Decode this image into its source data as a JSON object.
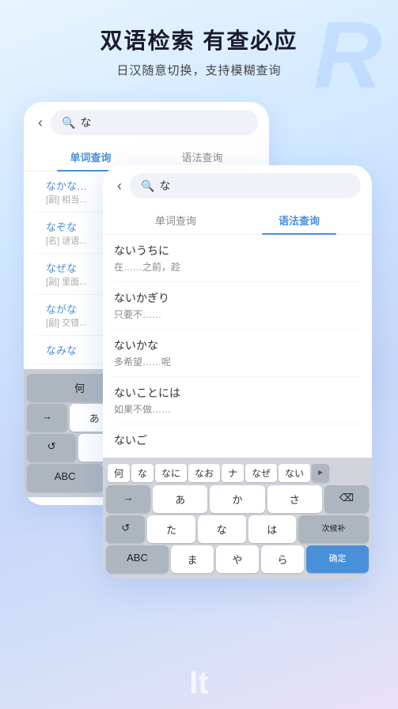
{
  "header": {
    "title": "双语检索 有查必应",
    "subtitle": "日汉随意切换，支持模糊查询",
    "bg_logo": "R"
  },
  "back_card": {
    "back_btn": "‹",
    "search_query": "な",
    "search_placeholder": "な",
    "tabs": [
      {
        "label": "单词查询",
        "active": true
      },
      {
        "label": "语法查询",
        "active": false
      }
    ],
    "results": [
      {
        "japanese": "なかな...",
        "tag": "[副]",
        "desc": "相当..."
      },
      {
        "japanese": "なぞな",
        "tag": "[名]",
        "desc": "谜语..."
      },
      {
        "japanese": "なぜな",
        "tag": "[副]",
        "desc": "里面..."
      },
      {
        "japanese": "ながな",
        "tag": "[副]",
        "desc": "交错..."
      }
    ]
  },
  "front_card": {
    "back_btn": "‹",
    "search_query": "な",
    "tabs": [
      {
        "label": "单词查询",
        "active": false
      },
      {
        "label": "语法查询",
        "active": true
      }
    ],
    "results": [
      {
        "japanese": "ないうちに",
        "chinese": "在……之前，趁"
      },
      {
        "japanese": "ないかぎり",
        "chinese": "只要不……"
      },
      {
        "japanese": "ないかな",
        "chinese": "多希望……呢"
      },
      {
        "japanese": "ないことには",
        "chinese": "如果不做……"
      },
      {
        "japanese": "ないご",
        "chinese": ""
      }
    ],
    "keyboard": {
      "suggestions": [
        "何",
        "な",
        "なに",
        "なお",
        "ナ",
        "なぜ",
        "ない",
        "▸"
      ],
      "rows": [
        [
          "→",
          "あ",
          "か",
          "さ",
          "⌫"
        ],
        [
          "↺",
          "た",
          "な",
          "は",
          "次候补"
        ],
        [
          "ABC",
          "ま",
          "や",
          "ら",
          "确定"
        ]
      ]
    }
  },
  "bottom_text": "It"
}
